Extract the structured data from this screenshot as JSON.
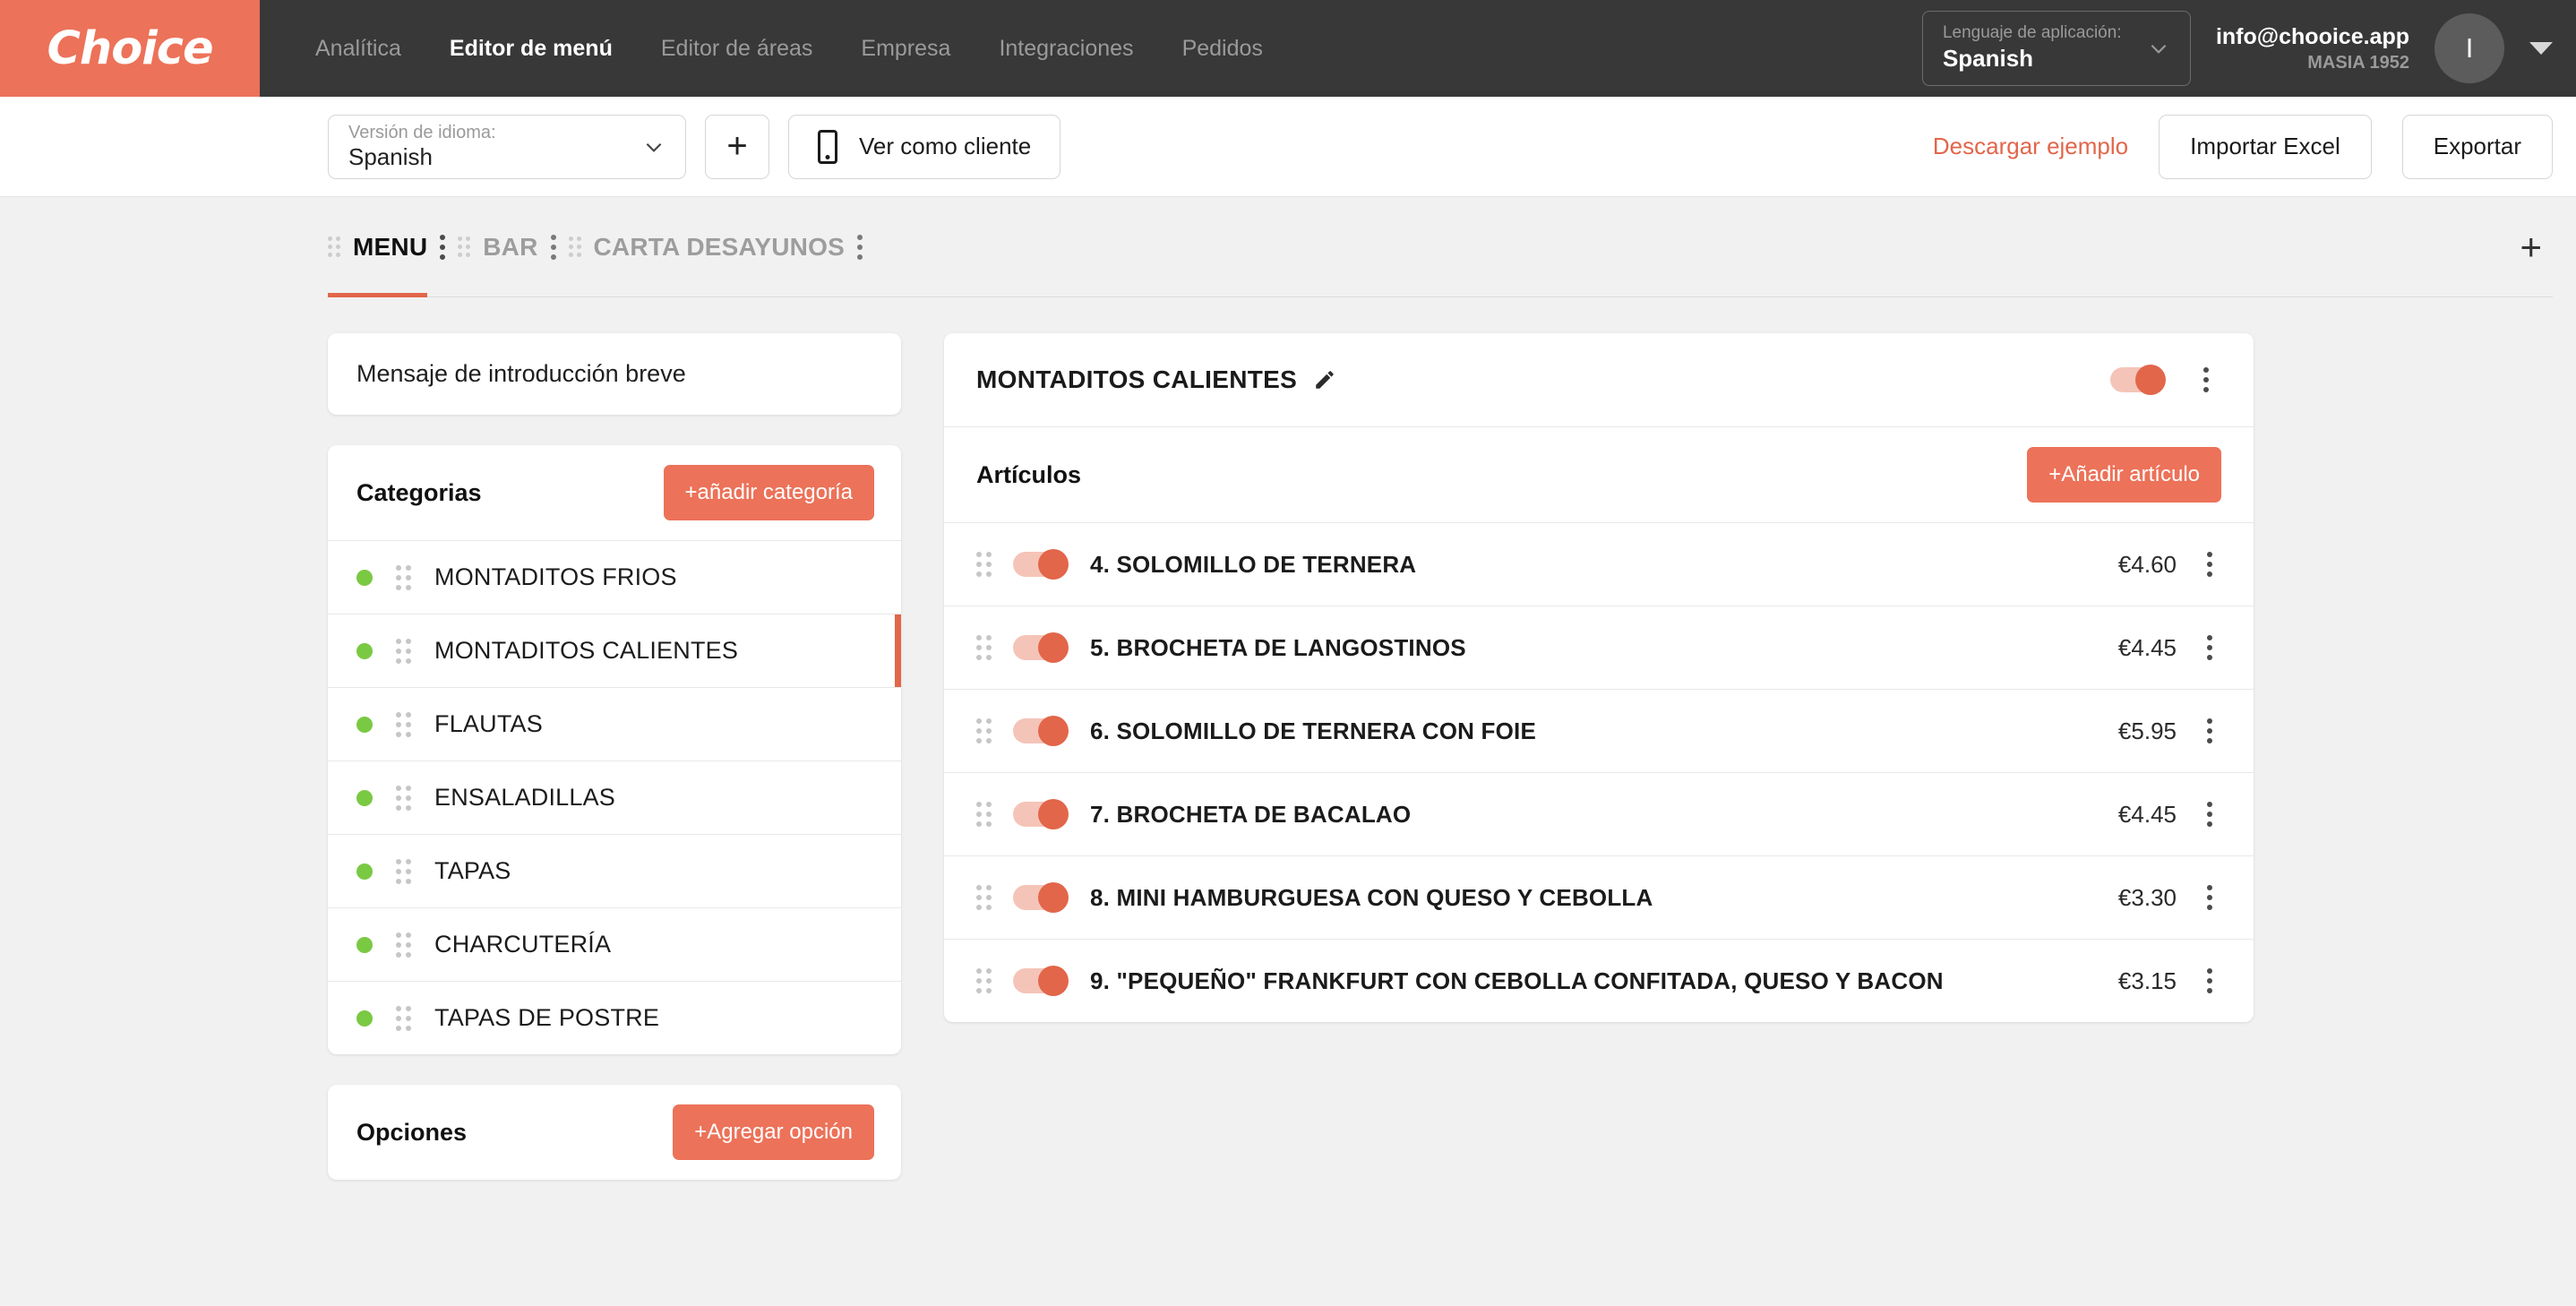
{
  "brand": {
    "logo_text": "Choice",
    "accent": "#ec7259",
    "accent_dark": "#e2664a",
    "nav_bg": "#383838",
    "page_bg": "#f1f1f1",
    "dot_green": "#7ac943"
  },
  "topnav": {
    "links": [
      {
        "label": "Analítica",
        "active": false
      },
      {
        "label": "Editor de menú",
        "active": true
      },
      {
        "label": "Editor de áreas",
        "active": false
      },
      {
        "label": "Empresa",
        "active": false
      },
      {
        "label": "Integraciones",
        "active": false
      },
      {
        "label": "Pedidos",
        "active": false
      }
    ],
    "app_language": {
      "label": "Lenguaje de aplicación:",
      "value": "Spanish",
      "icon": "chevron-down-icon"
    },
    "account": {
      "email": "info@chooice.app",
      "org": "MASIA 1952",
      "avatar_initial": "I",
      "caret": "caret-down-icon"
    }
  },
  "toolbar": {
    "language_version": {
      "label": "Versión de idioma:",
      "value": "Spanish"
    },
    "add_language_label": "+",
    "view_as_client_label": "Ver como cliente",
    "download_example_label": "Descargar ejemplo",
    "import_excel_label": "Importar Excel",
    "export_label": "Exportar"
  },
  "tabs": {
    "items": [
      {
        "label": "MENU",
        "active": true
      },
      {
        "label": "BAR",
        "active": false
      },
      {
        "label": "CARTA DESAYUNOS",
        "active": false
      }
    ],
    "add_tab_label": "+"
  },
  "sidebar": {
    "intro_message": "Mensaje de introducción breve",
    "categories_title": "Categorias",
    "add_category_label": "+añadir categoría",
    "categories": [
      {
        "label": "MONTADITOS FRIOS",
        "selected": false,
        "status": "active"
      },
      {
        "label": "MONTADITOS CALIENTES",
        "selected": true,
        "status": "active"
      },
      {
        "label": "FLAUTAS",
        "selected": false,
        "status": "active"
      },
      {
        "label": "ENSALADILLAS",
        "selected": false,
        "status": "active"
      },
      {
        "label": "TAPAS",
        "selected": false,
        "status": "active"
      },
      {
        "label": "CHARCUTERÍA",
        "selected": false,
        "status": "active"
      },
      {
        "label": "TAPAS DE POSTRE",
        "selected": false,
        "status": "active"
      }
    ],
    "options_title": "Opciones",
    "add_option_label": "+Agregar opción"
  },
  "panel": {
    "category_title": "MONTADITOS CALIENTES",
    "edit_icon": "pencil-icon",
    "category_enabled": true,
    "items_title": "Artículos",
    "add_item_label": "+Añadir artículo",
    "items": [
      {
        "name": "4. SOLOMILLO DE TERNERA",
        "price": "€4.60",
        "enabled": true
      },
      {
        "name": "5. BROCHETA DE LANGOSTINOS",
        "price": "€4.45",
        "enabled": true
      },
      {
        "name": "6. SOLOMILLO DE TERNERA CON FOIE",
        "price": "€5.95",
        "enabled": true
      },
      {
        "name": "7. BROCHETA DE BACALAO",
        "price": "€4.45",
        "enabled": true
      },
      {
        "name": "8. MINI HAMBURGUESA CON QUESO Y CEBOLLA",
        "price": "€3.30",
        "enabled": true
      },
      {
        "name": "9. \"PEQUEÑO\" FRANKFURT CON CEBOLLA CONFITADA, QUESO Y BACON",
        "price": "€3.15",
        "enabled": true
      }
    ]
  }
}
